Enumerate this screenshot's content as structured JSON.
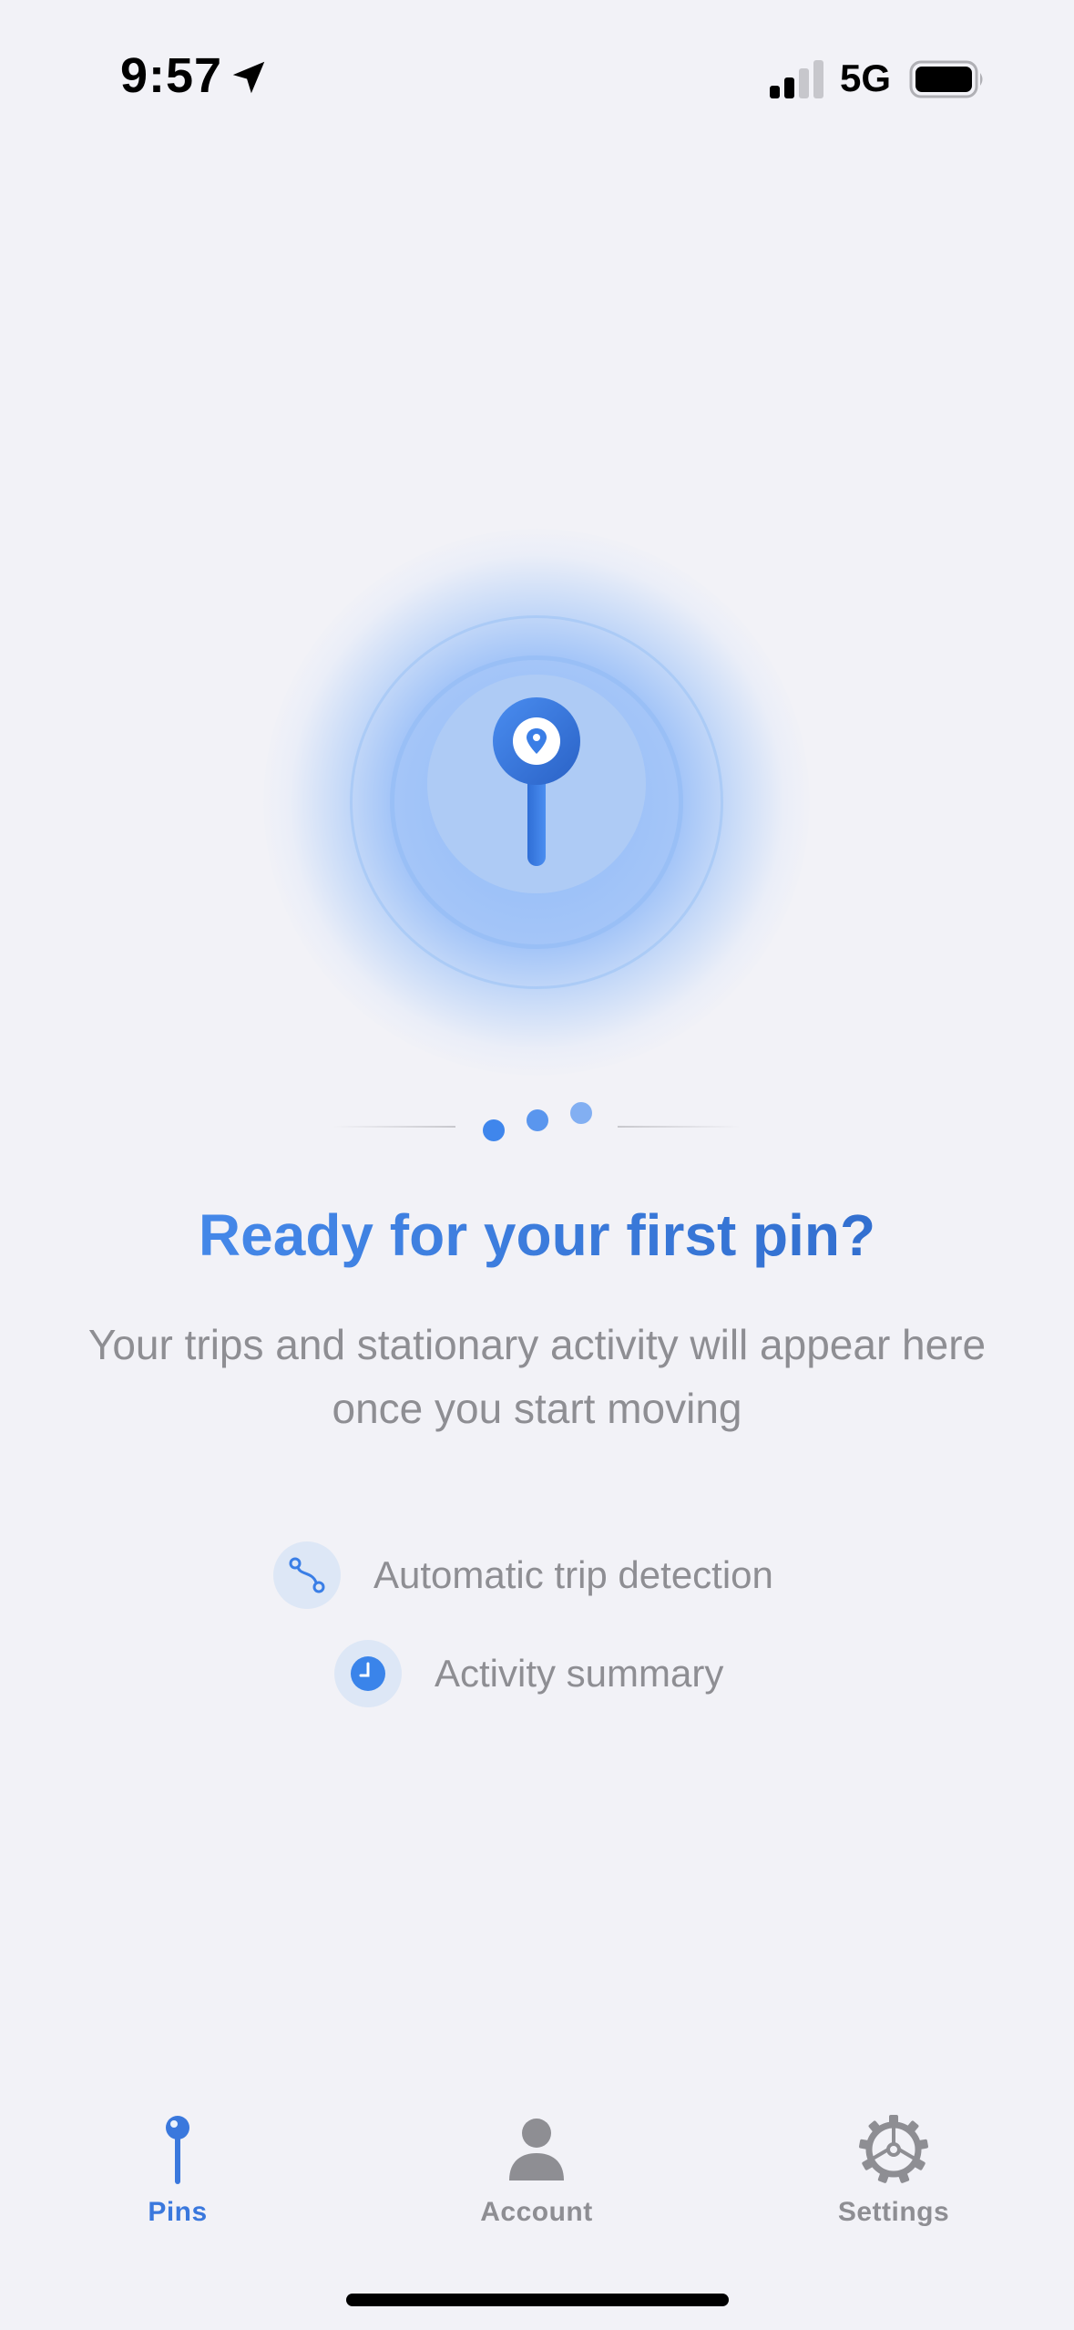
{
  "status_bar": {
    "time": "9:57",
    "network": "5G",
    "location_icon": "location-arrow-icon",
    "signal_icon": "cellular-signal-icon",
    "battery_icon": "battery-icon"
  },
  "hero": {
    "icon": "map-pin-icon"
  },
  "pagination": {
    "dot_count": 3
  },
  "empty_state": {
    "title": "Ready for your first pin?",
    "subtitle": "Your trips and stationary activity will appear here once you start moving"
  },
  "features": [
    {
      "icon": "route-icon",
      "label": "Automatic trip detection"
    },
    {
      "icon": "clock-icon",
      "label": "Activity summary"
    }
  ],
  "tab_bar": {
    "tabs": [
      {
        "icon": "pin-icon",
        "label": "Pins",
        "active": true
      },
      {
        "icon": "person-icon",
        "label": "Account",
        "active": false
      },
      {
        "icon": "gear-icon",
        "label": "Settings",
        "active": false
      }
    ]
  },
  "colors": {
    "accent": "#3a78dd",
    "background": "#f2f2f7",
    "secondary_text": "#8e8e93"
  }
}
